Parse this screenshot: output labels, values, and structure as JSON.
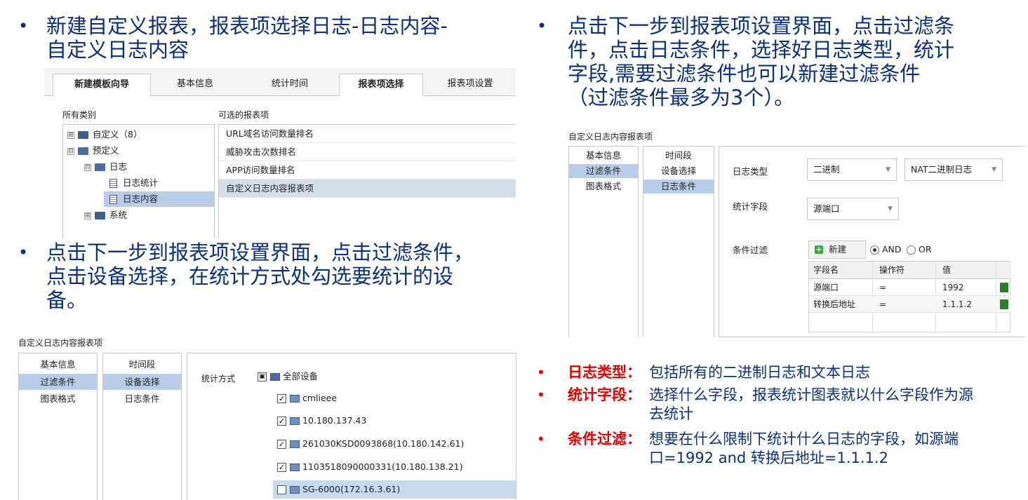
{
  "bullets": {
    "b1": "新建自定义报表，报表项选择日志-日志内容-\n自定义日志内容",
    "b2": "点击下一步到报表项设置界面，点击过滤条件，\n点击设备选择，在统计方式处勾选要统计的设\n备。",
    "b3": "点击下一步到报表项设置界面，点击过滤条\n件，点击日志条件，选择好日志类型，统计\n字段,需要过滤条件也可以新建过滤条件\n（过滤条件最多为3个）。",
    "marker": "•"
  },
  "panel1": {
    "tabs": [
      "新建模板向导",
      "基本信息",
      "统计时间",
      "报表项选择",
      "报表项设置"
    ],
    "active_tab_index": 3,
    "category_label": "所有类别",
    "options_label": "可选的报表项",
    "tree": [
      {
        "label": "自定义（8）",
        "expander": "⊞",
        "level": 0
      },
      {
        "label": "预定义",
        "expander": "⊟",
        "level": 0
      },
      {
        "label": "日志",
        "expander": "⊟",
        "level": 1
      },
      {
        "label": "日志统计",
        "level": 2
      },
      {
        "label": "日志内容",
        "level": 2,
        "selected": true
      },
      {
        "label": "系统",
        "expander": "⊞",
        "level": 1
      }
    ],
    "options": [
      "URL域名访问数量排名",
      "威胁攻击次数排名",
      "APP访问数量排名",
      "自定义日志内容报表项"
    ],
    "selected_option_index": 3
  },
  "panel2": {
    "title": "自定义日志内容报表项",
    "left_items": [
      "基本信息",
      "过滤条件",
      "图表格式"
    ],
    "left_selected": 1,
    "mid_items": [
      "时间段",
      "设备选择",
      "日志条件"
    ],
    "mid_selected": 1,
    "stat_label": "统计方式",
    "root_label": "全部设备",
    "devices": [
      {
        "name": "cmlieee",
        "checked": true
      },
      {
        "name": "10.180.137.43",
        "checked": true
      },
      {
        "name": "261030KSD0093868(10.180.142.61)",
        "checked": true
      },
      {
        "name": "1103518090000331(10.180.138.21)",
        "checked": true
      },
      {
        "name": "SG-6000(172.16.3.61)",
        "checked": false
      }
    ]
  },
  "panel3": {
    "title": "自定义日志内容报表项",
    "left_items": [
      "基本信息",
      "过滤条件",
      "图表格式"
    ],
    "left_selected": 1,
    "mid_items": [
      "时间段",
      "设备选择",
      "日志条件"
    ],
    "mid_selected": 2,
    "log_type_label": "日志类型",
    "log_type_value": "二进制",
    "log_subtype_value": "NAT二进制日志",
    "stat_field_label": "统计字段",
    "stat_field_value": "源端口",
    "cond_filter_label": "条件过滤",
    "new_button": "新建",
    "radio_and": "AND",
    "radio_or": "OR",
    "headers": [
      "字段名",
      "操作符",
      "值"
    ],
    "rows": [
      {
        "field": "源端口",
        "op": "=",
        "value": "1992"
      },
      {
        "field": "转换后地址",
        "op": "=",
        "value": "1.1.1.2"
      }
    ]
  },
  "definitions": [
    {
      "key": "日志类型：",
      "text": "包括所有的二进制日志和文本日志"
    },
    {
      "key": "统计字段：",
      "text": "选择什么字段，报表统计图表就以什么字段作为源\n去统计"
    },
    {
      "key": "条件过滤：",
      "text": "想要在什么限制下统计什么日志的字段，如源端\n口=1992 and 转换后地址=1.1.1.2"
    }
  ],
  "colors": {
    "heading": "#0c2f7a",
    "key_red": "#e00000",
    "selection": "#b8cce8"
  }
}
